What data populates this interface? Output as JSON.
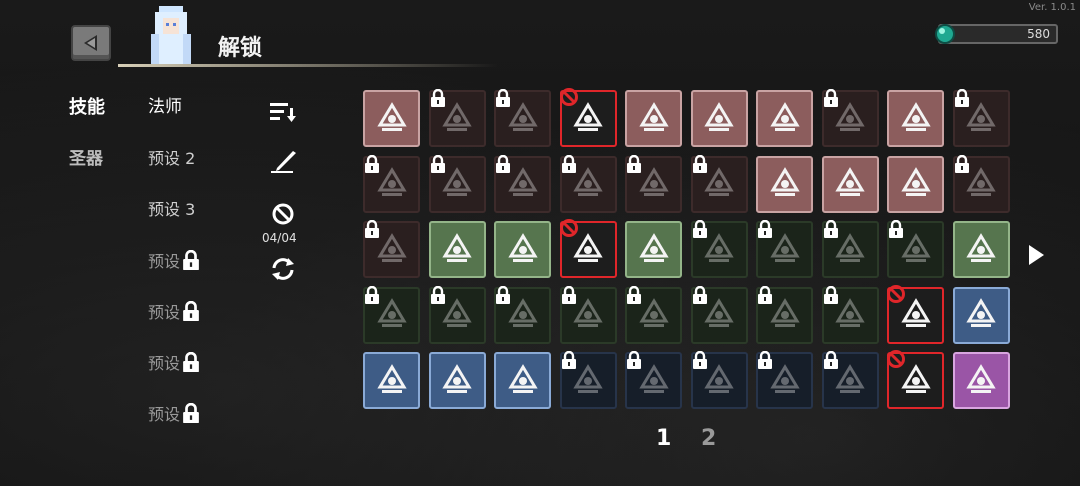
{
  "version": "Ver. 1.0.1",
  "header": {
    "title": "解锁",
    "currency_value": "580"
  },
  "tabs": {
    "skill": "技能",
    "relic": "圣器"
  },
  "presets": [
    {
      "label": "法师",
      "locked": false
    },
    {
      "label": "预设 2",
      "locked": false
    },
    {
      "label": "预设 3",
      "locked": false
    },
    {
      "label": "预设",
      "locked": true
    },
    {
      "label": "预设",
      "locked": true
    },
    {
      "label": "预设",
      "locked": true
    },
    {
      "label": "预设",
      "locked": true
    }
  ],
  "tools": {
    "count_label": "04/04"
  },
  "pagination": {
    "page1": "1",
    "page2": "2"
  },
  "colors": {
    "red_tile": "#8c5d5d",
    "green_tile": "#56754e",
    "blue_tile": "#3e5c86",
    "purple_tile": "#9a55a6",
    "forbid_border": "#e0262a"
  },
  "grid_rows": [
    [
      {
        "icon": "slash-orbit-icon",
        "color": "red",
        "state": "unlocked"
      },
      {
        "icon": "wind-blade-icon",
        "color": "red",
        "state": "locked"
      },
      {
        "icon": "flower-burst-icon",
        "color": "red",
        "state": "locked"
      },
      {
        "icon": "spark-burst-icon",
        "color": "red",
        "state": "forbidden"
      },
      {
        "icon": "arrow-up-icon",
        "color": "red",
        "state": "unlocked"
      },
      {
        "icon": "compass-icon",
        "color": "red",
        "state": "unlocked"
      },
      {
        "icon": "potion-flask-icon",
        "color": "red",
        "state": "unlocked"
      },
      {
        "icon": "vortex-icon",
        "color": "red",
        "state": "locked"
      },
      {
        "icon": "triple-arrows-icon",
        "color": "red",
        "state": "unlocked"
      },
      {
        "icon": "skull-icon",
        "color": "red",
        "state": "locked"
      }
    ],
    [
      {
        "icon": "wave-icon",
        "color": "red",
        "state": "locked"
      },
      {
        "icon": "rune-stones-icon",
        "color": "red",
        "state": "locked"
      },
      {
        "icon": "fire-claw-icon",
        "color": "red",
        "state": "locked"
      },
      {
        "icon": "target-orb-icon",
        "color": "red",
        "state": "locked"
      },
      {
        "icon": "broken-sword-icon",
        "color": "red",
        "state": "locked"
      },
      {
        "icon": "swirl-icon",
        "color": "red",
        "state": "locked"
      },
      {
        "icon": "bullseye-icon",
        "color": "red",
        "state": "unlocked"
      },
      {
        "icon": "fire-dash-icon",
        "color": "red",
        "state": "unlocked"
      },
      {
        "icon": "cloud-burst-icon",
        "color": "red",
        "state": "unlocked"
      },
      {
        "icon": "gauntlet-icon",
        "color": "red",
        "state": "locked"
      }
    ],
    [
      {
        "icon": "eye-ring-icon",
        "color": "red",
        "state": "locked"
      },
      {
        "icon": "shard-slash-icon",
        "color": "green",
        "state": "unlocked"
      },
      {
        "icon": "spiked-chain-icon",
        "color": "green",
        "state": "unlocked"
      },
      {
        "icon": "crack-icon",
        "color": "red",
        "state": "forbidden"
      },
      {
        "icon": "trap-flower-icon",
        "color": "green",
        "state": "unlocked"
      },
      {
        "icon": "shell-icon",
        "color": "green",
        "state": "locked"
      },
      {
        "icon": "demon-face-icon",
        "color": "green",
        "state": "locked"
      },
      {
        "icon": "biohazard-icon",
        "color": "green",
        "state": "locked"
      },
      {
        "icon": "sword-beam-icon",
        "color": "green",
        "state": "locked"
      },
      {
        "icon": "flame-jar-icon",
        "color": "green",
        "state": "unlocked"
      }
    ],
    [
      {
        "icon": "crescent-icon",
        "color": "green",
        "state": "locked"
      },
      {
        "icon": "needles-icon",
        "color": "green",
        "state": "locked"
      },
      {
        "icon": "bat-wing-icon",
        "color": "green",
        "state": "locked"
      },
      {
        "icon": "shatter-icon",
        "color": "green",
        "state": "locked"
      },
      {
        "icon": "thorns-icon",
        "color": "green",
        "state": "locked"
      },
      {
        "icon": "feather-icon",
        "color": "green",
        "state": "locked"
      },
      {
        "icon": "shuriken-icon",
        "color": "green",
        "state": "locked"
      },
      {
        "icon": "cog-ring-icon",
        "color": "green",
        "state": "locked"
      },
      {
        "icon": "octagon-shield-icon",
        "color": "red",
        "state": "forbidden"
      },
      {
        "icon": "ghost-flame-icon",
        "color": "blue",
        "state": "unlocked"
      }
    ],
    [
      {
        "icon": "hourglass-icon",
        "color": "blue",
        "state": "unlocked"
      },
      {
        "icon": "stairs-up-icon",
        "color": "blue",
        "state": "unlocked"
      },
      {
        "icon": "sword-up-icon",
        "color": "blue",
        "state": "unlocked"
      },
      {
        "icon": "star-burst-icon",
        "color": "blue",
        "state": "locked"
      },
      {
        "icon": "mask-icon",
        "color": "blue",
        "state": "locked"
      },
      {
        "icon": "broken-blade-icon",
        "color": "blue",
        "state": "locked"
      },
      {
        "icon": "sun-disc-icon",
        "color": "blue",
        "state": "locked"
      },
      {
        "icon": "scythe-icon",
        "color": "blue",
        "state": "locked"
      },
      {
        "icon": "dust-cloud-icon",
        "color": "red",
        "state": "forbidden"
      },
      {
        "icon": "magic-fist-icon",
        "color": "purple",
        "state": "unlocked"
      }
    ]
  ]
}
